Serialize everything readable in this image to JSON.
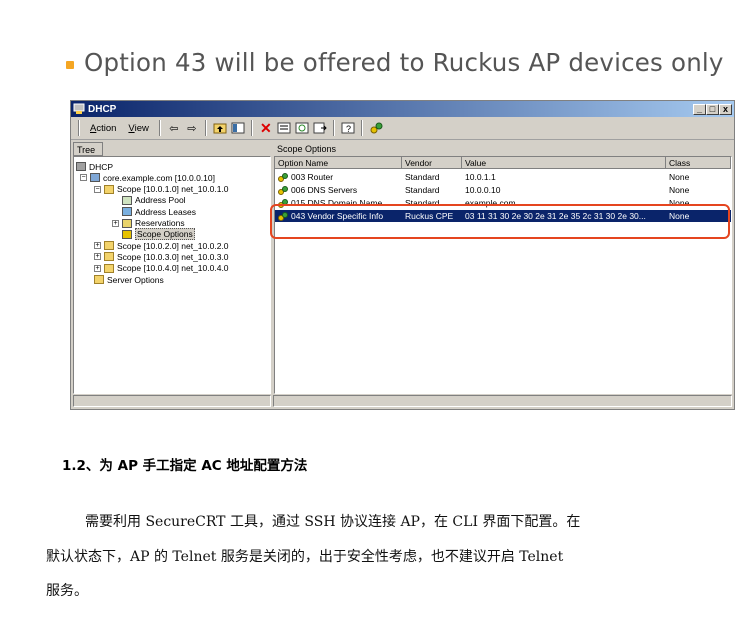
{
  "slide": {
    "title": "Option 43 will be offered to Ruckus AP devices only"
  },
  "window": {
    "title": "DHCP",
    "controls": [
      "_",
      "□",
      "x"
    ],
    "menu": [
      {
        "underline": "A",
        "rest": "ction"
      },
      {
        "underline": "V",
        "rest": "iew"
      }
    ],
    "toolbar_icons": [
      "back-icon",
      "forward-icon",
      "up-folder-icon",
      "show-hide-tree-icon",
      "delete-icon",
      "properties-icon",
      "refresh-icon",
      "export-icon",
      "help-icon",
      "dhcp-option-icon"
    ]
  },
  "tree": {
    "header": "Tree",
    "nodes": [
      {
        "label": "DHCP",
        "level": 0,
        "icon": "dhcp-server-icon",
        "pm": ""
      },
      {
        "label": "core.example.com [10.0.0.10]",
        "level": 1,
        "icon": "server-icon",
        "pm": "−"
      },
      {
        "label": "Scope [10.0.1.0] net_10.0.1.0",
        "level": 2,
        "icon": "folder-icon",
        "pm": "−"
      },
      {
        "label": "Address Pool",
        "level": 3,
        "icon": "address-pool-icon",
        "pm": ""
      },
      {
        "label": "Address Leases",
        "level": 3,
        "icon": "address-leases-icon",
        "pm": ""
      },
      {
        "label": "Reservations",
        "level": 3,
        "icon": "reservations-icon",
        "pm": "+"
      },
      {
        "label": "Scope Options",
        "level": 3,
        "icon": "scope-options-icon",
        "pm": "",
        "selected": true
      },
      {
        "label": "Scope [10.0.2.0] net_10.0.2.0",
        "level": 2,
        "icon": "folder-icon",
        "pm": "+"
      },
      {
        "label": "Scope [10.0.3.0] net_10.0.3.0",
        "level": 2,
        "icon": "folder-icon",
        "pm": "+"
      },
      {
        "label": "Scope [10.0.4.0] net_10.0.4.0",
        "level": 2,
        "icon": "folder-icon",
        "pm": "+"
      },
      {
        "label": "Server Options",
        "level": 2,
        "icon": "folder-icon",
        "pm": ""
      }
    ]
  },
  "list": {
    "header": "Scope Options",
    "columns": [
      "Option Name",
      "Vendor",
      "Value",
      "Class"
    ],
    "rows": [
      {
        "name": "003 Router",
        "vendor": "Standard",
        "value": "10.0.1.1",
        "class": "None"
      },
      {
        "name": "006 DNS Servers",
        "vendor": "Standard",
        "value": "10.0.0.10",
        "class": "None"
      },
      {
        "name": "015 DNS Domain Name",
        "vendor": "Standard",
        "value": "example.com",
        "class": "None"
      },
      {
        "name": "043 Vendor Specific Info",
        "vendor": "Ruckus CPE",
        "value": "03 11 31 30 2e 30 2e 31 2e 35 2c 31 30 2e 30...",
        "class": "None",
        "selected": true
      }
    ]
  },
  "colors": {
    "accent": "#f5a623",
    "highlight": "#e5451f",
    "selection": "#0a246a"
  },
  "section": {
    "heading": "1.2、为 AP 手工指定 AC 地址配置方法",
    "lines": [
      "需要利用 SecureCRT 工具，通过 SSH 协议连接 AP，在 CLI 界面下配置。在",
      "默认状态下，AP 的 Telnet 服务是关闭的，出于安全性考虑，也不建议开启 Telnet",
      "服务。"
    ]
  }
}
